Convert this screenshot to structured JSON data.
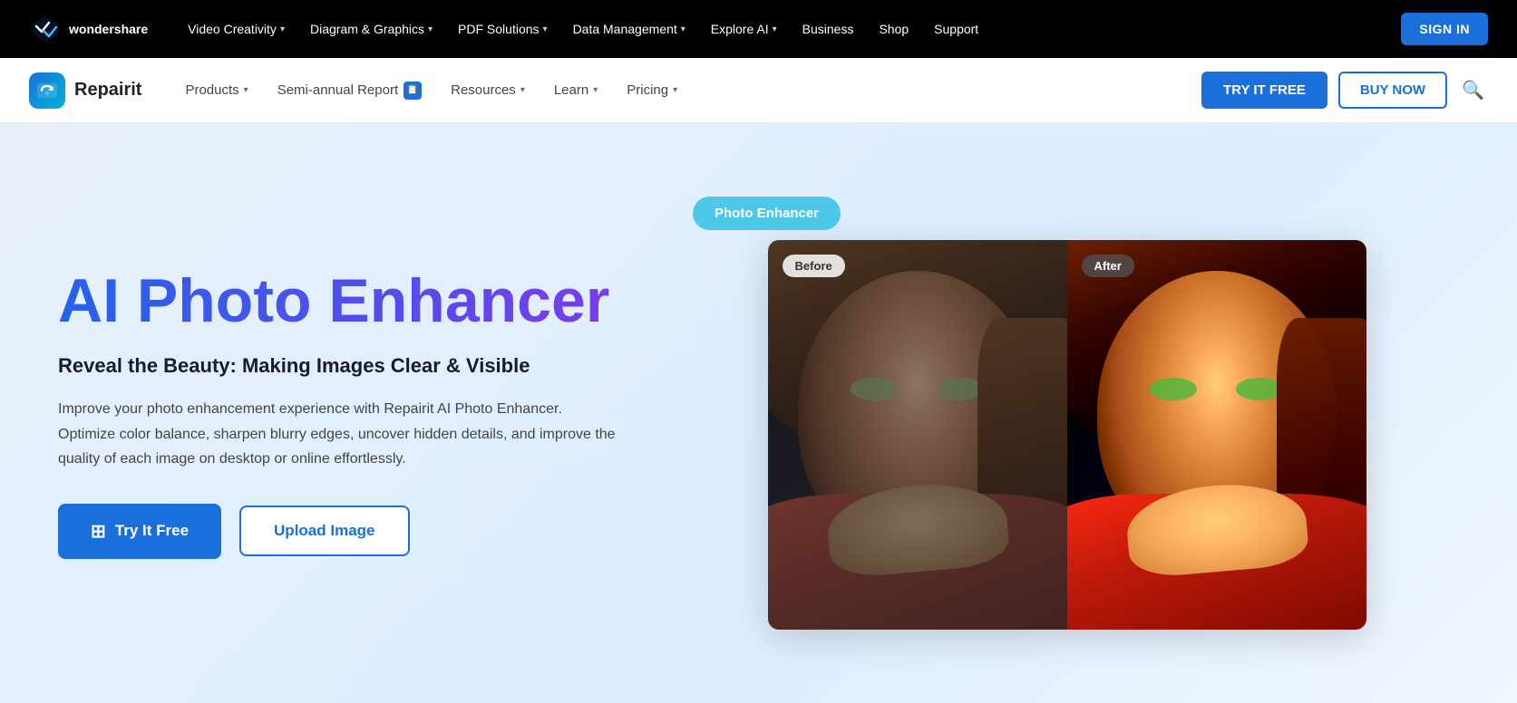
{
  "topnav": {
    "logo_name": "wondershare",
    "logo_line1": "wonder",
    "logo_line2": "share",
    "items": [
      {
        "label": "Video Creativity",
        "has_dropdown": true
      },
      {
        "label": "Diagram & Graphics",
        "has_dropdown": true
      },
      {
        "label": "PDF Solutions",
        "has_dropdown": true
      },
      {
        "label": "Data Management",
        "has_dropdown": true
      },
      {
        "label": "Explore AI",
        "has_dropdown": true
      },
      {
        "label": "Business"
      },
      {
        "label": "Shop"
      },
      {
        "label": "Support"
      }
    ],
    "sign_in_label": "SIGN IN"
  },
  "subnav": {
    "brand": "Repairit",
    "items": [
      {
        "label": "Products",
        "has_dropdown": true
      },
      {
        "label": "Semi-annual Report",
        "has_badge": true
      },
      {
        "label": "Resources",
        "has_dropdown": true
      },
      {
        "label": "Learn",
        "has_dropdown": true
      },
      {
        "label": "Pricing",
        "has_dropdown": true
      }
    ],
    "try_free_label": "TRY IT FREE",
    "buy_now_label": "BUY NOW"
  },
  "hero": {
    "title": "AI Photo Enhancer",
    "subtitle": "Reveal the Beauty: Making Images Clear & Visible",
    "description": "Improve your photo enhancement experience with Repairit AI Photo Enhancer. Optimize color balance, sharpen blurry edges, uncover hidden details, and improve the quality of each image on desktop or online effortlessly.",
    "try_free_btn": "Try It Free",
    "upload_btn": "Upload Image",
    "photo_enhancer_badge": "Photo Enhancer",
    "before_label": "Before",
    "after_label": "After"
  },
  "colors": {
    "primary": "#1a6fda",
    "gradient_start": "#2563eb",
    "gradient_end": "#7c3aed",
    "badge_color": "#4dc8e8"
  }
}
